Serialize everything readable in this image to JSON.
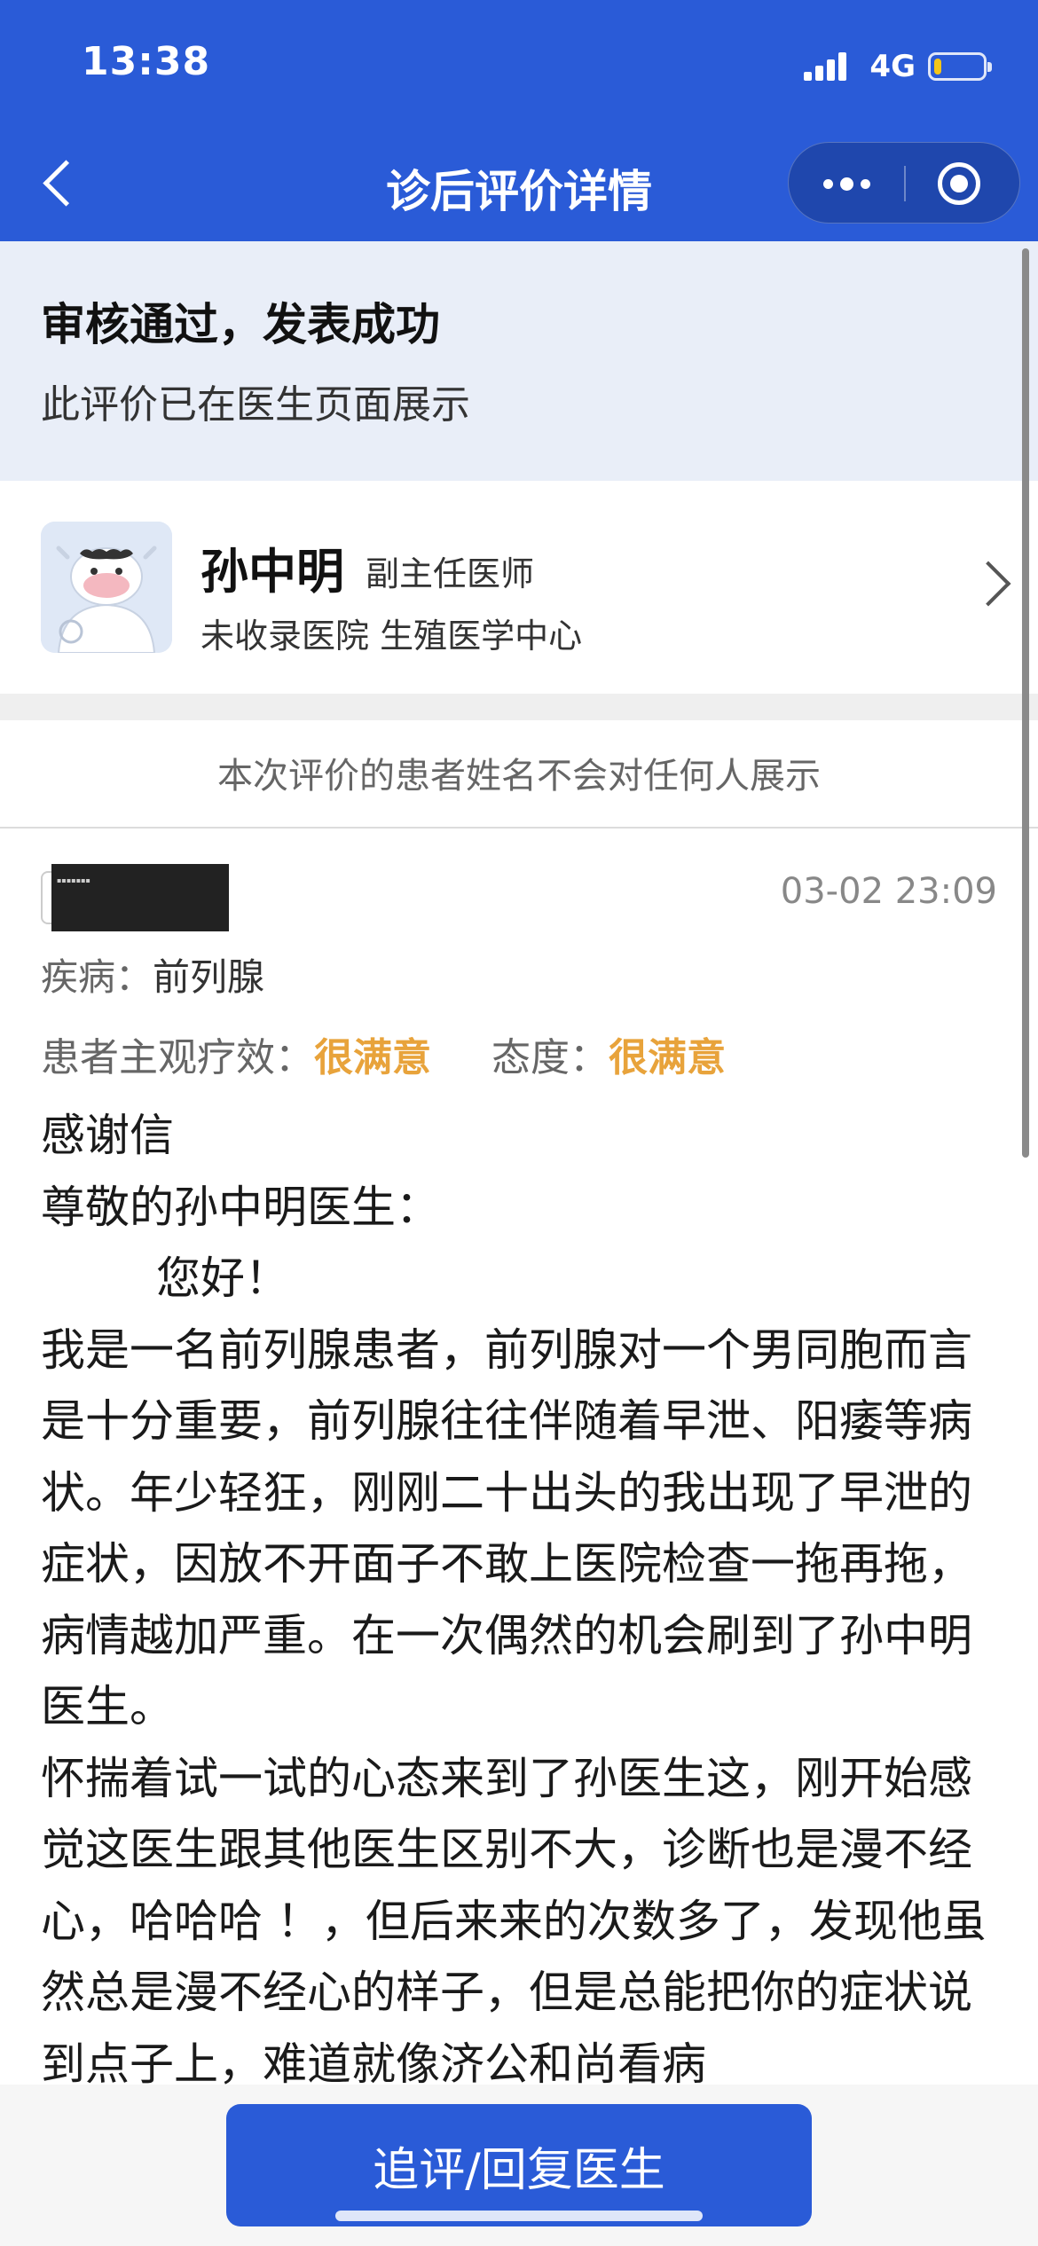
{
  "status_bar": {
    "time": "13:38",
    "network": "4G",
    "battery_level_percent": 15
  },
  "nav": {
    "title": "诊后评价详情",
    "icons": {
      "back": "chevron-left-icon",
      "more": "more-dots-icon",
      "close": "target-circle-icon"
    }
  },
  "banner": {
    "title": "审核通过，发表成功",
    "subtitle": "此评价已在医生页面展示"
  },
  "doctor": {
    "name": "孙中明",
    "title": "副主任医师",
    "hospital": "未收录医院 生殖医学中心"
  },
  "privacy_notice": "本次评价的患者姓名不会对任何人展示",
  "review": {
    "date": "03-02 23:09",
    "disease_label": "疾病：",
    "disease": "前列腺",
    "efficacy_label": "患者主观疗效：",
    "efficacy": "很满意",
    "attitude_label": "态度：",
    "attitude": "很满意",
    "body": {
      "line1": "感谢信",
      "line2": "尊敬的孙中明医生：",
      "line3": "您好！",
      "para1": "我是一名前列腺患者，前列腺对一个男同胞而言是十分重要，前列腺往往伴随着早泄、阳痿等病状。年少轻狂，刚刚二十出头的我出现了早泄的症状，因放不开面子不敢上医院检查一拖再拖，病情越加严重。在一次偶然的机会刷到了孙中明医生。",
      "para2": "怀揣着试一试的心态来到了孙医生这，刚开始感觉这医生跟其他医生区别不大，诊断也是漫不经心，哈哈哈 ！，但后来来的次数多了，发现他虽然总是漫不经心的样子，但是总能把你的症状说到点子上，难道就像济公和尚看病"
    }
  },
  "cta": {
    "label": "追评/回复医生"
  },
  "colors": {
    "brand_blue": "#2a5bd7",
    "banner_bg": "#e9eef8",
    "rating_orange": "#e8a33b"
  }
}
